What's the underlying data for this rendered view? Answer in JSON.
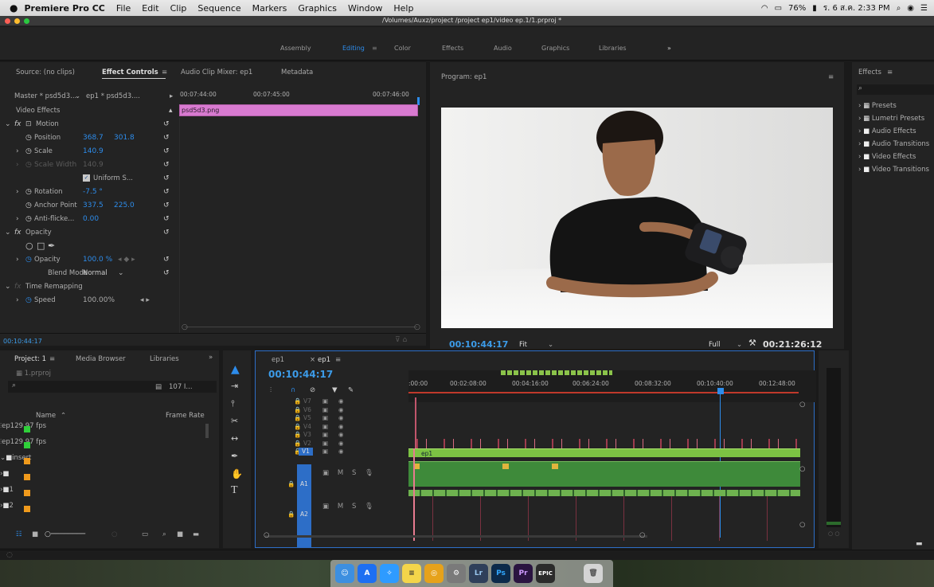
{
  "menubar": {
    "app": "Premiere Pro CC",
    "items": [
      "File",
      "Edit",
      "Clip",
      "Sequence",
      "Markers",
      "Graphics",
      "Window",
      "Help"
    ],
    "battery": "76%",
    "clock": "ร. 6 ส.ค. 2:33 PM"
  },
  "window": {
    "path": "/Volumes/Auxz/project /project ep1/video ep.1/1.prproj *"
  },
  "workspaces": [
    "Assembly",
    "Editing",
    "Color",
    "Effects",
    "Audio",
    "Graphics",
    "Libraries"
  ],
  "source_tabs": {
    "source": "Source: (no clips)",
    "effect_controls": "Effect Controls",
    "audio_mixer": "Audio Clip Mixer: ep1",
    "metadata": "Metadata"
  },
  "ec": {
    "master": "Master * psd5d3....",
    "seq": "ep1 * psd5d3....",
    "t1": "00:07:44:00",
    "t2": "00:07:45:00",
    "t3": "00:07:46:00",
    "video_effects": "Video Effects",
    "clip": "psd5d3.png",
    "motion": "Motion",
    "position": "Position",
    "pos_x": "368.7",
    "pos_y": "301.8",
    "scale": "Scale",
    "scale_v": "140.9",
    "scale_width": "Scale Width",
    "scale_width_v": "140.9",
    "uniform": "Uniform S...",
    "rotation": "Rotation",
    "rotation_v": "-7.5 °",
    "anchor": "Anchor Point",
    "anchor_x": "337.5",
    "anchor_y": "225.0",
    "anti": "Anti-flicke...",
    "anti_v": "0.00",
    "opacity_fx": "Opacity",
    "opacity": "Opacity",
    "opacity_v": "100.0 %",
    "blend": "Blend Mode",
    "blend_v": "Normal",
    "time_remap": "Time Remapping",
    "speed": "Speed",
    "speed_v": "100.00%",
    "timecode": "00:10:44:17"
  },
  "program": {
    "title": "Program: ep1",
    "timecode": "00:10:44:17",
    "fit": "Fit",
    "full": "Full",
    "duration": "00:21:26:12"
  },
  "effects": {
    "title": "Effects",
    "items": [
      "Presets",
      "Lumetri Presets",
      "Audio Effects",
      "Audio Transitions",
      "Video Effects",
      "Video Transitions"
    ]
  },
  "project": {
    "tab": "Project: 1",
    "media_browser": "Media Browser",
    "libraries": "Libraries",
    "file": "1.prproj",
    "count": "107 I...",
    "col_name": "Name",
    "col_rate": "Frame Rate",
    "items": [
      {
        "name": "ep1",
        "rate": "29.97 fps",
        "color": "#2fcf3a"
      },
      {
        "name": "ep1",
        "rate": "29.97 fps",
        "color": "#2fcf3a"
      },
      {
        "name": "insert",
        "rate": "",
        "color": "#f09a1c"
      },
      {
        "name": "",
        "rate": "",
        "color": "#f09a1c"
      },
      {
        "name": "1",
        "rate": "",
        "color": "#f09a1c"
      },
      {
        "name": "2",
        "rate": "",
        "color": "#f09a1c"
      }
    ]
  },
  "timeline": {
    "tab1": "ep1",
    "tab2": "ep1",
    "timecode": "00:10:44:17",
    "ruler": [
      ":00:00",
      "00:02:08:00",
      "00:04:16:00",
      "00:06:24:00",
      "00:08:32:00",
      "00:10:40:00",
      "00:12:48:00"
    ],
    "vtracks": [
      "V7",
      "V6",
      "V5",
      "V4",
      "V3",
      "V2",
      "V1"
    ],
    "atracks": [
      "A1",
      "A2"
    ],
    "clip_v1": "ep1"
  },
  "dock": [
    "Lr",
    "Ps",
    "Pr",
    "EPIC"
  ]
}
